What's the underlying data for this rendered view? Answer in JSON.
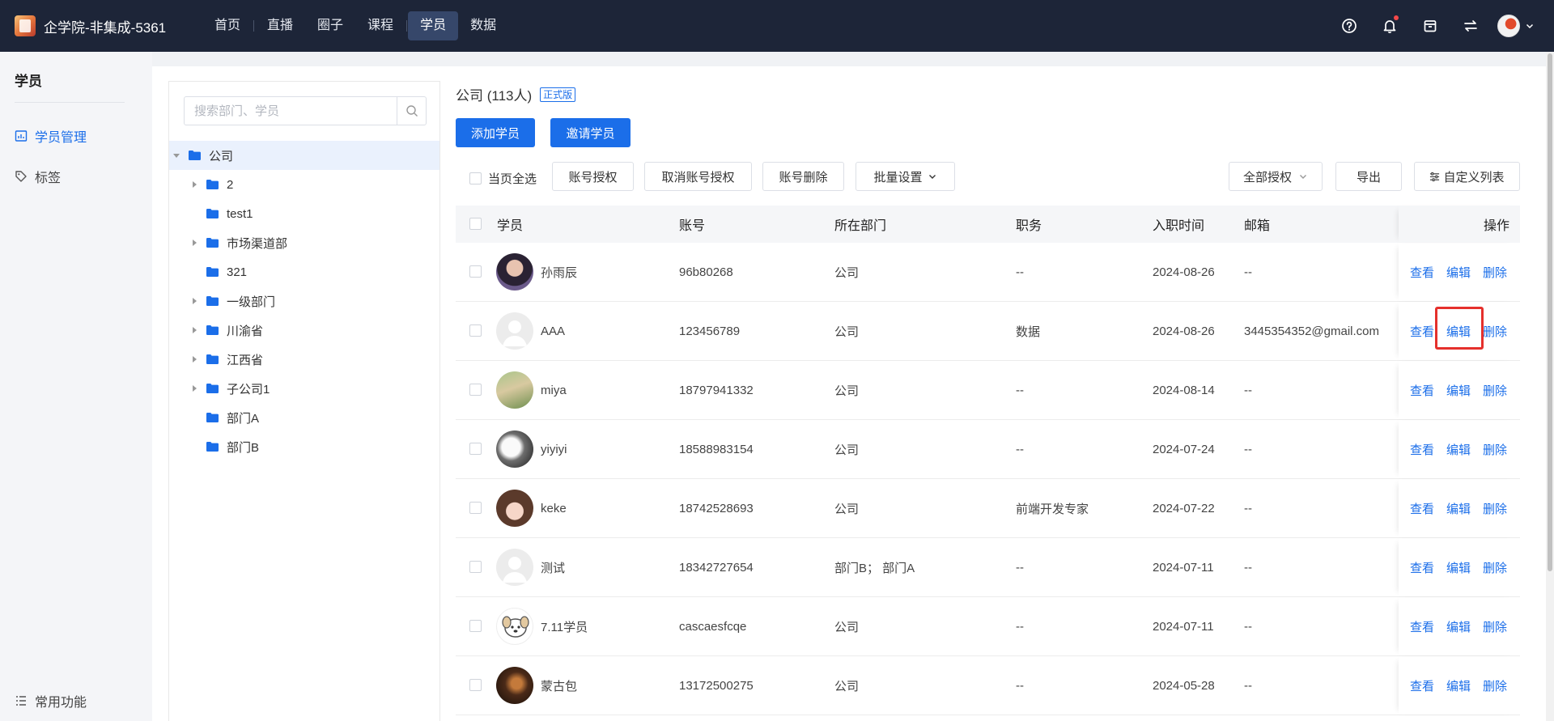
{
  "app": {
    "title": "企学院-非集成-5361"
  },
  "nav": [
    "首页",
    "直播",
    "圈子",
    "课程",
    "学员",
    "数据"
  ],
  "nav_active": 4,
  "sidebar": {
    "title": "学员",
    "items": [
      {
        "label": "学员管理",
        "icon": "bar-chart-icon",
        "active": true
      },
      {
        "label": "标签",
        "icon": "tag-icon",
        "active": false
      }
    ],
    "footer": "常用功能"
  },
  "search": {
    "placeholder": "搜索部门、学员"
  },
  "tree": {
    "root": "公司",
    "children": [
      {
        "label": "2",
        "expandable": true
      },
      {
        "label": "test1",
        "expandable": false
      },
      {
        "label": "市场渠道部",
        "expandable": true
      },
      {
        "label": "321",
        "expandable": false
      },
      {
        "label": "一级部门",
        "expandable": true
      },
      {
        "label": "川渝省",
        "expandable": true
      },
      {
        "label": "江西省",
        "expandable": true
      },
      {
        "label": "子公司1",
        "expandable": true
      },
      {
        "label": "部门A",
        "expandable": false
      },
      {
        "label": "部门B",
        "expandable": false
      }
    ]
  },
  "header": {
    "title": "公司 (113人)",
    "badge": "正式版"
  },
  "buttons": {
    "add": "添加学员",
    "invite": "邀请学员",
    "select_all": "当页全选",
    "grant": "账号授权",
    "revoke": "取消账号授权",
    "delete_account": "账号删除",
    "batch": "批量设置",
    "all_grant": "全部授权",
    "export": "导出",
    "custom_list": "自定义列表"
  },
  "table": {
    "headers": [
      "学员",
      "账号",
      "所在部门",
      "职务",
      "入职时间",
      "邮箱",
      "操作"
    ],
    "actions": [
      "查看",
      "编辑",
      "删除"
    ],
    "rows": [
      {
        "name": "孙雨辰",
        "account": "96b80268",
        "dept": "公司",
        "title": "--",
        "date": "2024-08-26",
        "email": "--",
        "avatar": "photo-girl"
      },
      {
        "name": "AAA",
        "account": "123456789",
        "dept": "公司",
        "title": "数据",
        "date": "2024-08-26",
        "email": "3445354352@gmail.com",
        "avatar": "default"
      },
      {
        "name": "miya",
        "account": "18797941332",
        "dept": "公司",
        "title": "--",
        "date": "2024-08-14",
        "email": "--",
        "avatar": "photo-nature"
      },
      {
        "name": "yiyiyi",
        "account": "18588983154",
        "dept": "公司",
        "title": "--",
        "date": "2024-07-24",
        "email": "--",
        "avatar": "photo-bw"
      },
      {
        "name": "keke",
        "account": "18742528693",
        "dept": "公司",
        "title": "前端开发专家",
        "date": "2024-07-22",
        "email": "--",
        "avatar": "photo-anime"
      },
      {
        "name": "测试",
        "account": "18342727654",
        "dept": "部门B； 部门A",
        "title": "--",
        "date": "2024-07-11",
        "email": "--",
        "avatar": "default"
      },
      {
        "name": "7.11学员",
        "account": "cascaesfcqe",
        "dept": "公司",
        "title": "--",
        "date": "2024-07-11",
        "email": "--",
        "avatar": "cartoon-dog"
      },
      {
        "name": "蒙古包",
        "account": "13172500275",
        "dept": "公司",
        "title": "--",
        "date": "2024-05-28",
        "email": "--",
        "avatar": "photo-dark"
      }
    ]
  },
  "colors": {
    "topbar": "#1d2538",
    "primary": "#1b6ee9",
    "highlight": "#e5302c"
  }
}
